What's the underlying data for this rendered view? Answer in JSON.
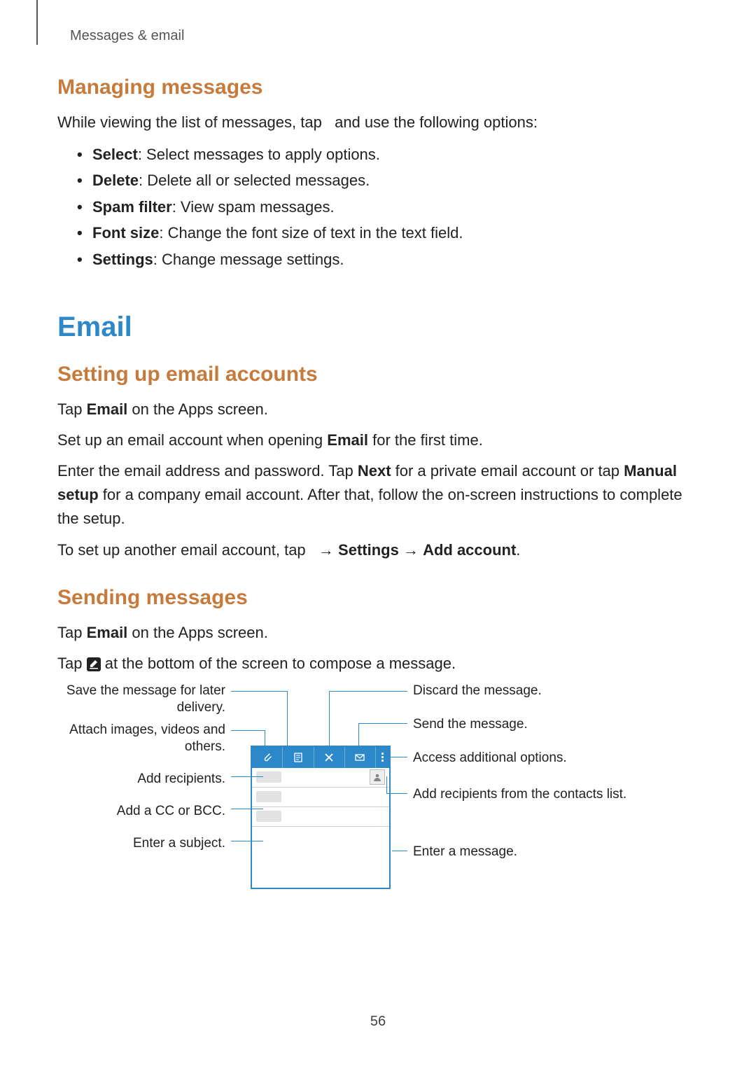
{
  "breadcrumb": "Messages & email",
  "section1": {
    "title": "Managing messages",
    "intro_before": "While viewing the list of messages, tap ",
    "intro_after": " and use the following options:",
    "items": [
      {
        "bold": "Select",
        "rest": ": Select messages to apply options."
      },
      {
        "bold": "Delete",
        "rest": ": Delete all or selected messages."
      },
      {
        "bold": "Spam filter",
        "rest": ": View spam messages."
      },
      {
        "bold": "Font size",
        "rest": ": Change the font size of text in the text field."
      },
      {
        "bold": "Settings",
        "rest": ": Change message settings."
      }
    ]
  },
  "h1": "Email",
  "section2": {
    "title": "Setting up email accounts",
    "p1": {
      "before": "Tap ",
      "bold": "Email",
      "after": " on the Apps screen."
    },
    "p2": {
      "before": "Set up an email account when opening ",
      "bold": "Email",
      "after": " for the first time."
    },
    "p3": {
      "t1": "Enter the email address and password. Tap ",
      "b1": "Next",
      "t2": " for a private email account or tap ",
      "b2": "Manual setup",
      "t3": " for a company email account. After that, follow the on-screen instructions to complete the setup."
    },
    "p4": {
      "t1": "To set up another email account, tap ",
      "arrow1": " → ",
      "b1": "Settings",
      "arrow2": " → ",
      "b2": "Add account",
      "t2": "."
    }
  },
  "section3": {
    "title": "Sending messages",
    "p1": {
      "before": "Tap ",
      "bold": "Email",
      "after": " on the Apps screen."
    },
    "p2": {
      "before": "Tap ",
      "after": " at the bottom of the screen to compose a message."
    }
  },
  "callouts": {
    "save": "Save the message for later delivery.",
    "attach": "Attach images, videos and others.",
    "recipients": "Add recipients.",
    "ccbcc": "Add a CC or BCC.",
    "subject": "Enter a subject.",
    "discard": "Discard the message.",
    "send": "Send the message.",
    "options": "Access additional options.",
    "contacts": "Add recipients from the contacts list.",
    "body": "Enter a message."
  },
  "page_number": "56"
}
